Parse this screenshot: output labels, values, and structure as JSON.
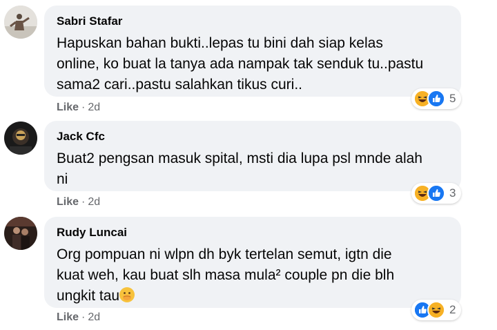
{
  "comments": [
    {
      "author": "Sabri Stafar",
      "lines": [
        "Hapuskan bahan bukti..lepas tu bini dah siap kelas",
        "online, ko buat la tanya ada nampak tak senduk tu..pastu",
        "sama2 cari..pastu salahkan tikus curi.."
      ],
      "like_label": "Like",
      "time": "2d",
      "reaction_count": "5",
      "reaction_icons": [
        "haha-icon",
        "like-icon"
      ]
    },
    {
      "author": "Jack Cfc",
      "lines": [
        "Buat2 pengsan masuk spital, msti dia lupa psl mnde alah",
        "ni"
      ],
      "like_label": "Like",
      "time": "2d",
      "reaction_count": "3",
      "reaction_icons": [
        "haha-icon",
        "like-icon"
      ]
    },
    {
      "author": "Rudy Luncai",
      "lines": [
        "Org pompuan ni wlpn dh byk tertelan semut, igtn die",
        "kuat weh, kau buat slh masa mula² couple pn die blh",
        "ungkit tau"
      ],
      "inline_emoji": "face-with-hand-over-mouth-emoji",
      "like_label": "Like",
      "time": "2d",
      "reaction_count": "2",
      "reaction_icons": [
        "like-icon",
        "haha-icon"
      ]
    }
  ],
  "colors": {
    "bubble": "#f0f2f5",
    "meta": "#65676b",
    "like_blue": "#1877f2",
    "haha_yellow": "#f7b125"
  }
}
